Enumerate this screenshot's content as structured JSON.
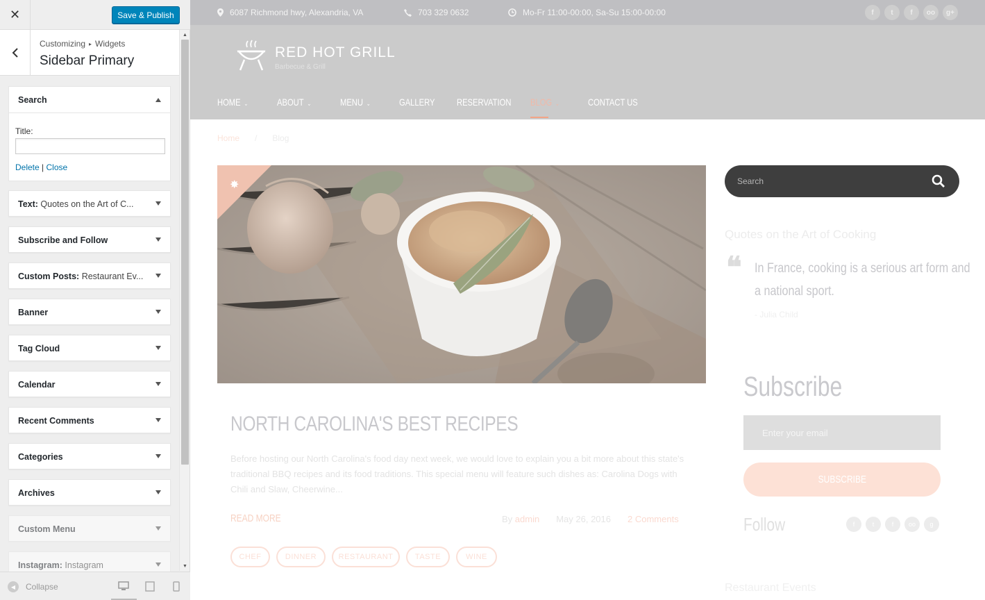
{
  "customizer": {
    "close_symbol": "✕",
    "publish_label": "Save & Publish",
    "breadcrumb": {
      "root": "Customizing",
      "sep": "▸",
      "section": "Widgets"
    },
    "title": "Sidebar Primary",
    "search_widget": {
      "title": "Search",
      "title_field_label": "Title:",
      "title_field_value": "",
      "delete_label": "Delete",
      "separator": "|",
      "close_label": "Close"
    },
    "widgets": [
      {
        "name": "Text",
        "sub": "Quotes on the Art of C..."
      },
      {
        "name": "Subscribe and Follow",
        "sub": ""
      },
      {
        "name": "Custom Posts",
        "sub": "Restaurant Ev..."
      },
      {
        "name": "Banner",
        "sub": ""
      },
      {
        "name": "Tag Cloud",
        "sub": ""
      },
      {
        "name": "Calendar",
        "sub": ""
      },
      {
        "name": "Recent Comments",
        "sub": ""
      },
      {
        "name": "Categories",
        "sub": ""
      },
      {
        "name": "Archives",
        "sub": ""
      },
      {
        "name": "Custom Menu",
        "sub": ""
      },
      {
        "name": "Instagram",
        "sub": "Instagram"
      }
    ],
    "collapse_label": "Collapse",
    "accent_color": "#0085ba"
  },
  "site": {
    "topbar": {
      "address": "6087 Richmond hwy, Alexandria, VA",
      "phone": "703 329 0632",
      "hours": "Mo-Fr 11:00-00:00, Sa-Su 15:00-00:00",
      "social_icons": [
        "foursquare-icon",
        "twitter-icon",
        "facebook-icon",
        "tripadvisor-icon",
        "google-plus-icon"
      ]
    },
    "logo": {
      "name": "RED HOT GRILL",
      "tagline": "Barbecue & Grill"
    },
    "nav": [
      {
        "label": "HOME",
        "dropdown": true
      },
      {
        "label": "ABOUT",
        "dropdown": true
      },
      {
        "label": "MENU",
        "dropdown": true
      },
      {
        "label": "GALLERY",
        "dropdown": false
      },
      {
        "label": "RESERVATION",
        "dropdown": false
      },
      {
        "label": "BLOG",
        "dropdown": true,
        "active": true
      },
      {
        "label": "CONTACT US",
        "dropdown": false
      }
    ],
    "breadcrumbs": {
      "home": "Home",
      "sep": "/",
      "current": "Blog"
    },
    "post": {
      "title": "NORTH CAROLINA'S BEST RECIPES",
      "excerpt": "Before hosting our North Carolina's food day next week, we would love to explain you a bit more about this state's traditional BBQ recipes and its food traditions. This special menu will feature such dishes as: Carolina Dogs with Chili and Slaw, Cheerwine...",
      "read_more": "READ MORE",
      "by": "By",
      "author": "admin",
      "date": "May 26, 2016",
      "comments": "2 Comments",
      "tags": [
        "CHEF",
        "DINNER",
        "RESTAURANT",
        "TASTE",
        "WINE"
      ]
    },
    "sidebar": {
      "search_placeholder": "Search",
      "quotes_title": "Quotes on the Art of Cooking",
      "quote_mark": "❝",
      "quote": "In France, cooking is a serious art form and a national sport.",
      "quote_author": "- Julia Child",
      "subscribe_title": "Subscribe",
      "email_placeholder": "Enter your email",
      "subscribe_button": "SUBSCRIBE",
      "follow_title": "Follow",
      "events_title": "Restaurant Events"
    }
  }
}
